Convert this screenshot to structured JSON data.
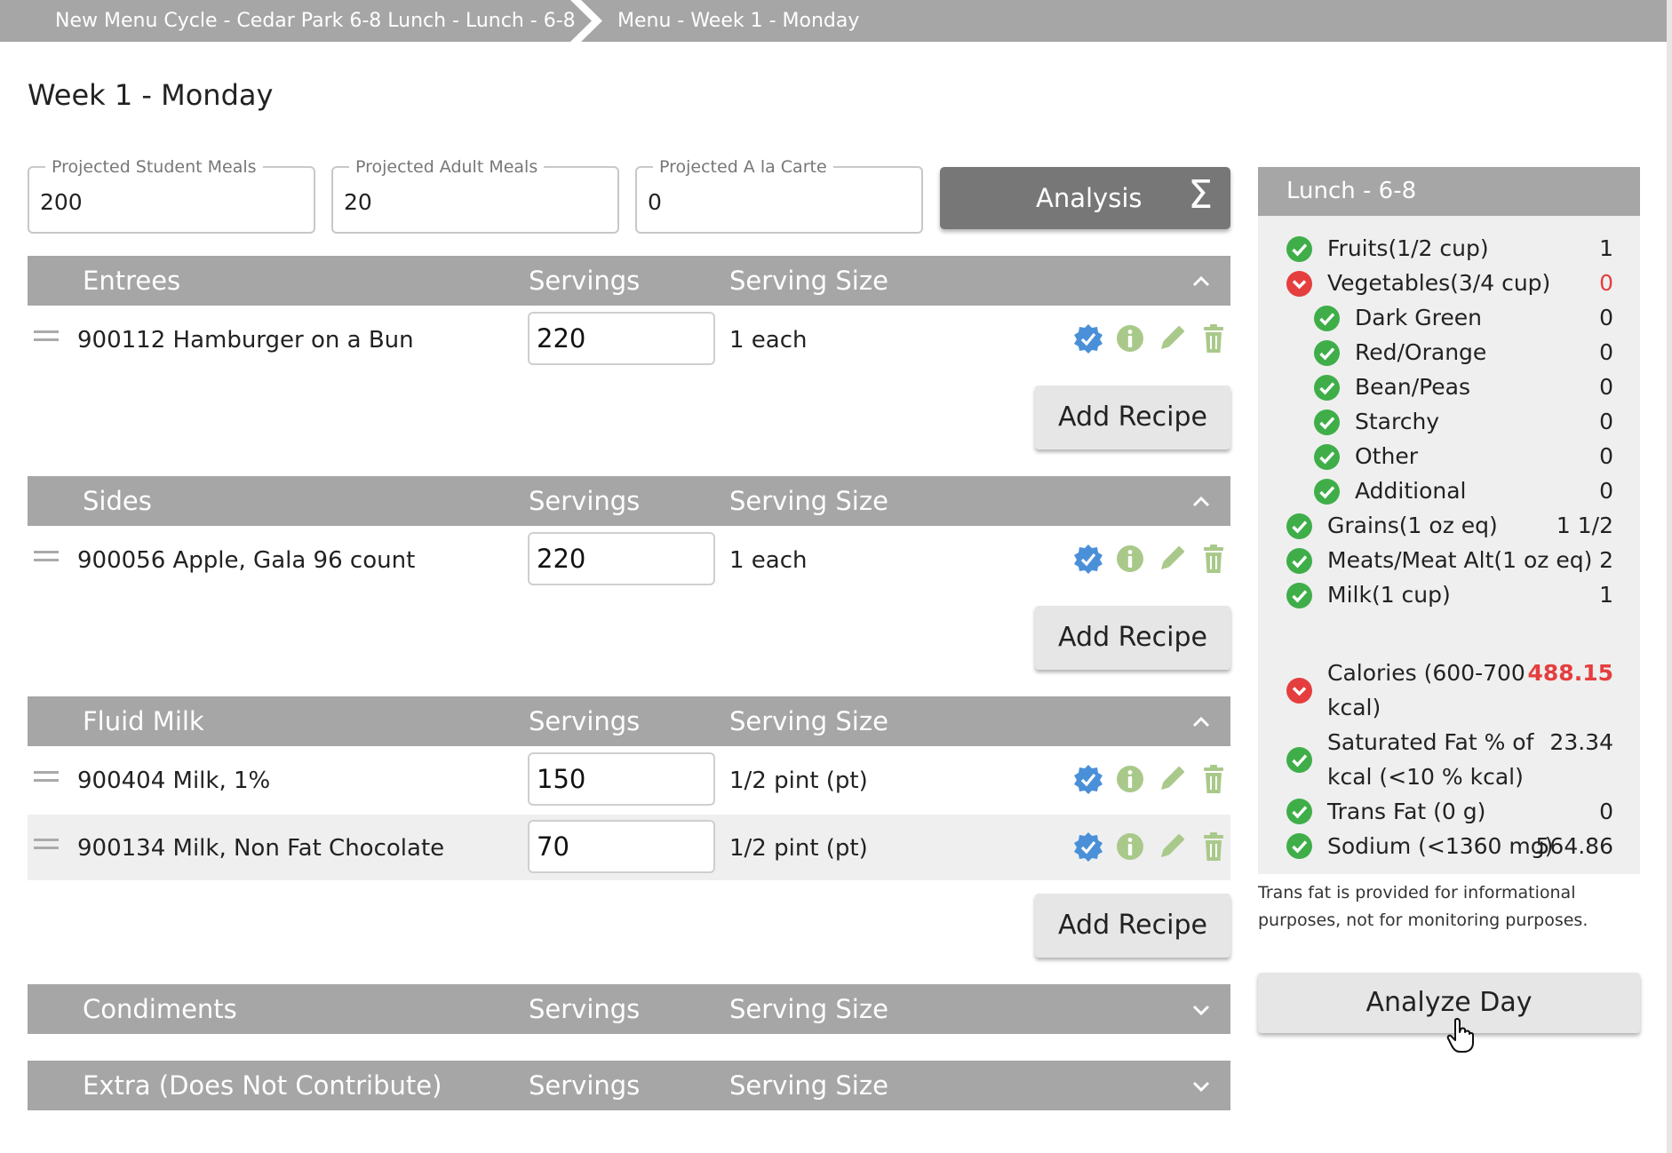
{
  "breadcrumb": {
    "items": [
      "New Menu Cycle - Cedar Park 6-8 Lunch - Lunch - 6-8",
      "Menu - Week 1 - Monday"
    ]
  },
  "page_title": "Week 1 - Monday",
  "projections": {
    "student": {
      "label": "Projected Student Meals",
      "value": "200"
    },
    "adult": {
      "label": "Projected Adult Meals",
      "value": "20"
    },
    "alacarte": {
      "label": "Projected A la Carte",
      "value": "0"
    }
  },
  "analysis_button": {
    "label": "Analysis",
    "icon": "sigma-icon"
  },
  "columns": {
    "servings": "Servings",
    "serving_size": "Serving Size"
  },
  "add_recipe_label": "Add Recipe",
  "sections": [
    {
      "name": "Entrees",
      "expanded": true,
      "rows": [
        {
          "name": "900112 Hamburger on a Bun",
          "servings": "220",
          "size": "1 each"
        }
      ]
    },
    {
      "name": "Sides",
      "expanded": true,
      "rows": [
        {
          "name": "900056 Apple, Gala 96 count",
          "servings": "220",
          "size": "1 each"
        }
      ]
    },
    {
      "name": "Fluid Milk",
      "expanded": true,
      "rows": [
        {
          "name": "900404 Milk, 1%",
          "servings": "150",
          "size": "1/2 pint (pt)"
        },
        {
          "name": "900134 Milk, Non Fat Chocolate",
          "servings": "70",
          "size": "1/2 pint (pt)"
        }
      ]
    },
    {
      "name": "Condiments",
      "expanded": false,
      "rows": []
    },
    {
      "name": "Extra (Does Not Contribute)",
      "expanded": false,
      "rows": []
    }
  ],
  "row_icons": [
    "verified-badge-icon",
    "info-icon",
    "edit-pencil-icon",
    "trash-icon"
  ],
  "side_panel": {
    "title": "Lunch - 6-8",
    "components": [
      {
        "label": "Fruits(1/2 cup)",
        "value": "1",
        "status": "ok",
        "indent": false
      },
      {
        "label": "Vegetables(3/4 cup)",
        "value": "0",
        "status": "fail",
        "indent": false
      },
      {
        "label": "Dark Green",
        "value": "0",
        "status": "ok",
        "indent": true
      },
      {
        "label": "Red/Orange",
        "value": "0",
        "status": "ok",
        "indent": true
      },
      {
        "label": "Bean/Peas",
        "value": "0",
        "status": "ok",
        "indent": true
      },
      {
        "label": "Starchy",
        "value": "0",
        "status": "ok",
        "indent": true
      },
      {
        "label": "Other",
        "value": "0",
        "status": "ok",
        "indent": true
      },
      {
        "label": "Additional",
        "value": "0",
        "status": "ok",
        "indent": true
      },
      {
        "label": "Grains(1 oz eq)",
        "value": "1 1/2",
        "status": "ok",
        "indent": false
      },
      {
        "label": "Meats/Meat Alt(1 oz eq)",
        "value": "2",
        "status": "ok",
        "indent": false
      },
      {
        "label": "Milk(1 cup)",
        "value": "1",
        "status": "ok",
        "indent": false
      }
    ],
    "nutrients": [
      {
        "label": "Calories (600-700 kcal)",
        "value": "488.15",
        "status": "fail"
      },
      {
        "label": "Saturated Fat % of kcal (<10 % kcal)",
        "value": "23.34",
        "status": "ok"
      },
      {
        "label": "Trans Fat (0 g)",
        "value": "0",
        "status": "ok"
      },
      {
        "label": "Sodium (<1360 mg)",
        "value": "564.86",
        "status": "ok"
      }
    ]
  },
  "trans_fat_note": "Trans fat is provided for informational purposes, not for monitoring purposes.",
  "analyze_day_label": "Analyze Day",
  "colors": {
    "ok": "#3fae49",
    "fail": "#e53e3e",
    "verified": "#4a90d9",
    "action": "#a9c98a",
    "header": "#a6a6a6"
  }
}
